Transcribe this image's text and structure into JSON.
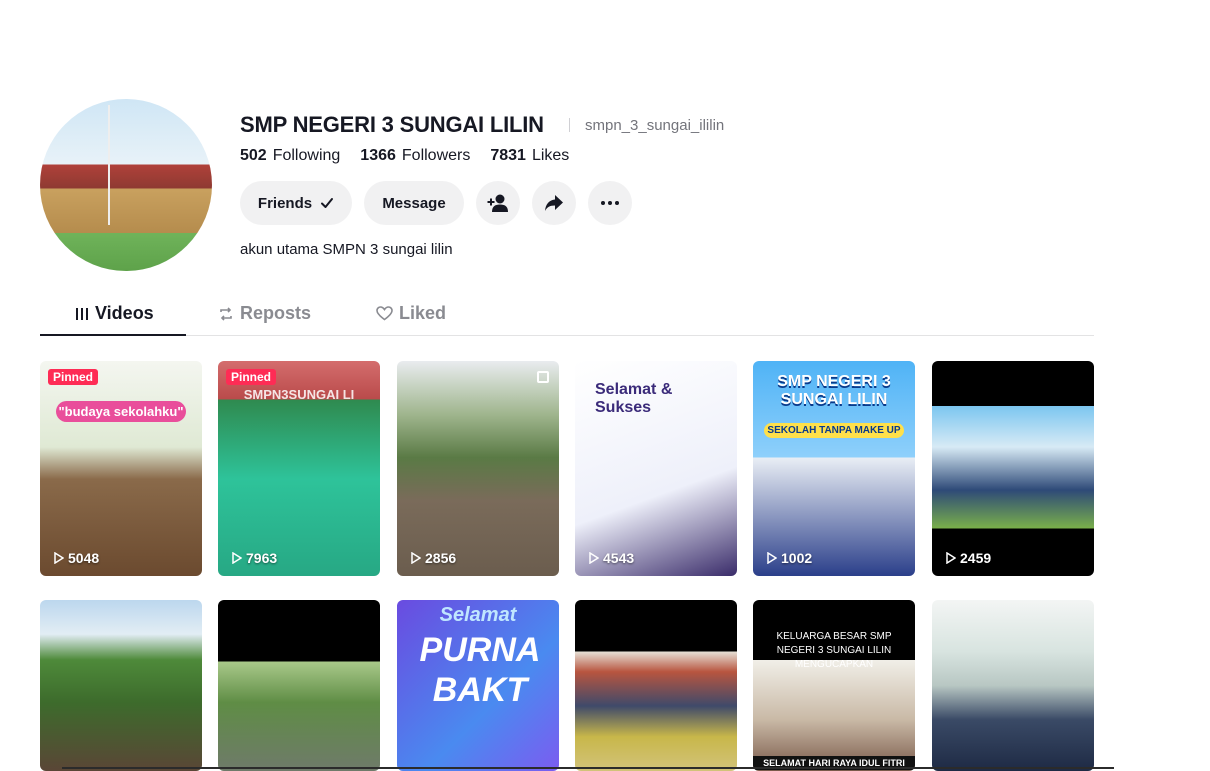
{
  "profile": {
    "name": "SMP NEGERI 3 SUNGAI LILIN",
    "username": "smpn_3_sungai_ililin",
    "bio": "akun utama SMPN 3 sungai lilin"
  },
  "stats": {
    "following_count": "502",
    "following_label": "Following",
    "followers_count": "1366",
    "followers_label": "Followers",
    "likes_count": "7831",
    "likes_label": "Likes"
  },
  "actions": {
    "friends_label": "Friends",
    "message_label": "Message",
    "add_icon": "person-add-icon",
    "share_icon": "share-arrow-icon",
    "more_icon": "more-dots-icon"
  },
  "tabs": [
    {
      "label": "Videos",
      "icon": "grid-bars-icon",
      "active": true
    },
    {
      "label": "Reposts",
      "icon": "repost-icon",
      "active": false
    },
    {
      "label": "Liked",
      "icon": "heart-outline-icon",
      "active": false
    }
  ],
  "videos": [
    {
      "views": "5048",
      "pinned": "Pinned",
      "overlay": "\"budaya sekolahku\""
    },
    {
      "views": "7963",
      "pinned": "Pinned",
      "overlay": "SMPN3SUNGAI LI"
    },
    {
      "views": "2856"
    },
    {
      "views": "4543",
      "overlay": "Selamat & Sukses"
    },
    {
      "views": "1002",
      "overlay": "SMP NEGERI 3 SUNGAI LILIN",
      "overlay2": "SEKOLAH TANPA MAKE UP"
    },
    {
      "views": "2459"
    },
    {},
    {},
    {
      "overlay": "Selamat",
      "overlay2": "PURNA BAKT"
    },
    {},
    {
      "overlay": "KELUARGA BESAR SMP NEGERI 3 SUNGAI LILIN MENGUCAPKAN",
      "overlay2": "SELAMAT HARI RAYA IDUL FITRI"
    },
    {}
  ],
  "colors": {
    "accent": "#fe2c55",
    "text": "#161823",
    "muted": "#73747b",
    "button_bg": "#f1f1f2"
  }
}
